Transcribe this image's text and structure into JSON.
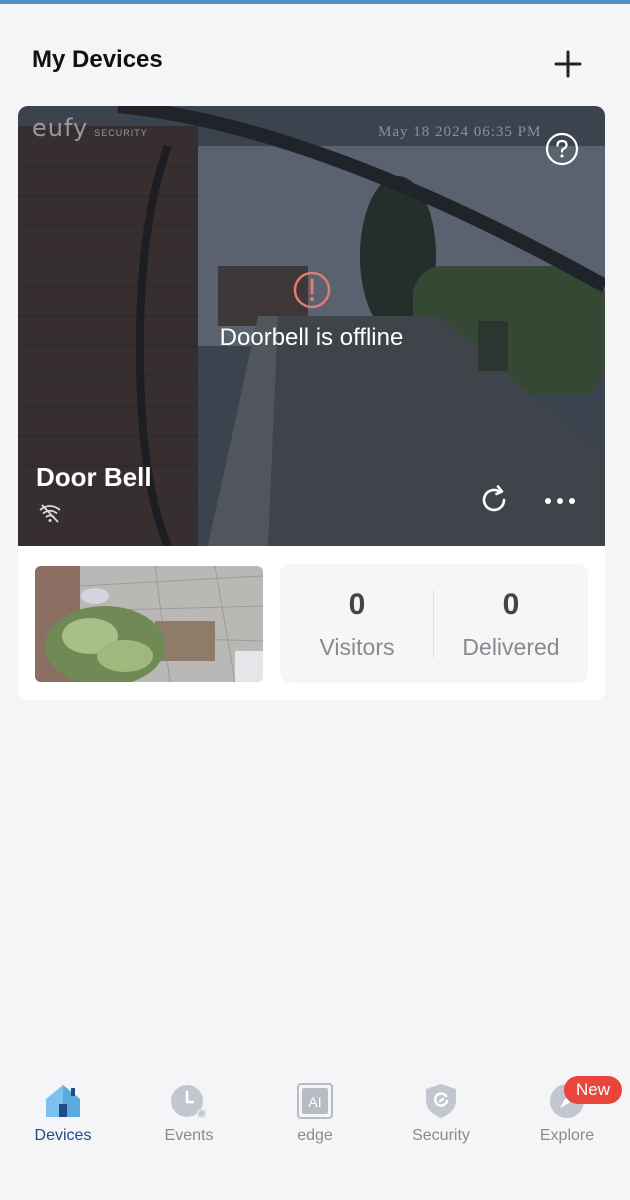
{
  "header": {
    "title": "My Devices",
    "add_icon": "plus-icon"
  },
  "device_card": {
    "brand_logo": "eufy",
    "brand_sub": "SECURITY",
    "timestamp": "May 18 2024  06:35 PM",
    "status_text": "Doorbell is offline",
    "status_icon": "alert-circle-icon",
    "device_name": "Door Bell",
    "wifi_status_icon": "wifi-off-icon",
    "help_icon": "question-icon",
    "refresh_icon": "refresh-icon",
    "more_icon": "more-horizontal-icon",
    "stats": {
      "visitors_value": "0",
      "visitors_label": "Visitors",
      "delivered_value": "0",
      "delivered_label": "Delivered"
    }
  },
  "tabbar": {
    "tabs": [
      {
        "label": "Devices",
        "icon": "house-icon",
        "active": true
      },
      {
        "label": "Events",
        "icon": "clock-icon",
        "active": false
      },
      {
        "label": "edge",
        "icon": "ai-chip-icon",
        "active": false
      },
      {
        "label": "Security",
        "icon": "shield-icon",
        "active": false
      },
      {
        "label": "Explore",
        "icon": "compass-icon",
        "active": false
      }
    ],
    "explore_badge": "New"
  },
  "colors": {
    "active_tab": "#1f4d86",
    "alert": "#e8463d",
    "offline_icon": "#e07a75",
    "top_accent": "#4a90c8"
  }
}
